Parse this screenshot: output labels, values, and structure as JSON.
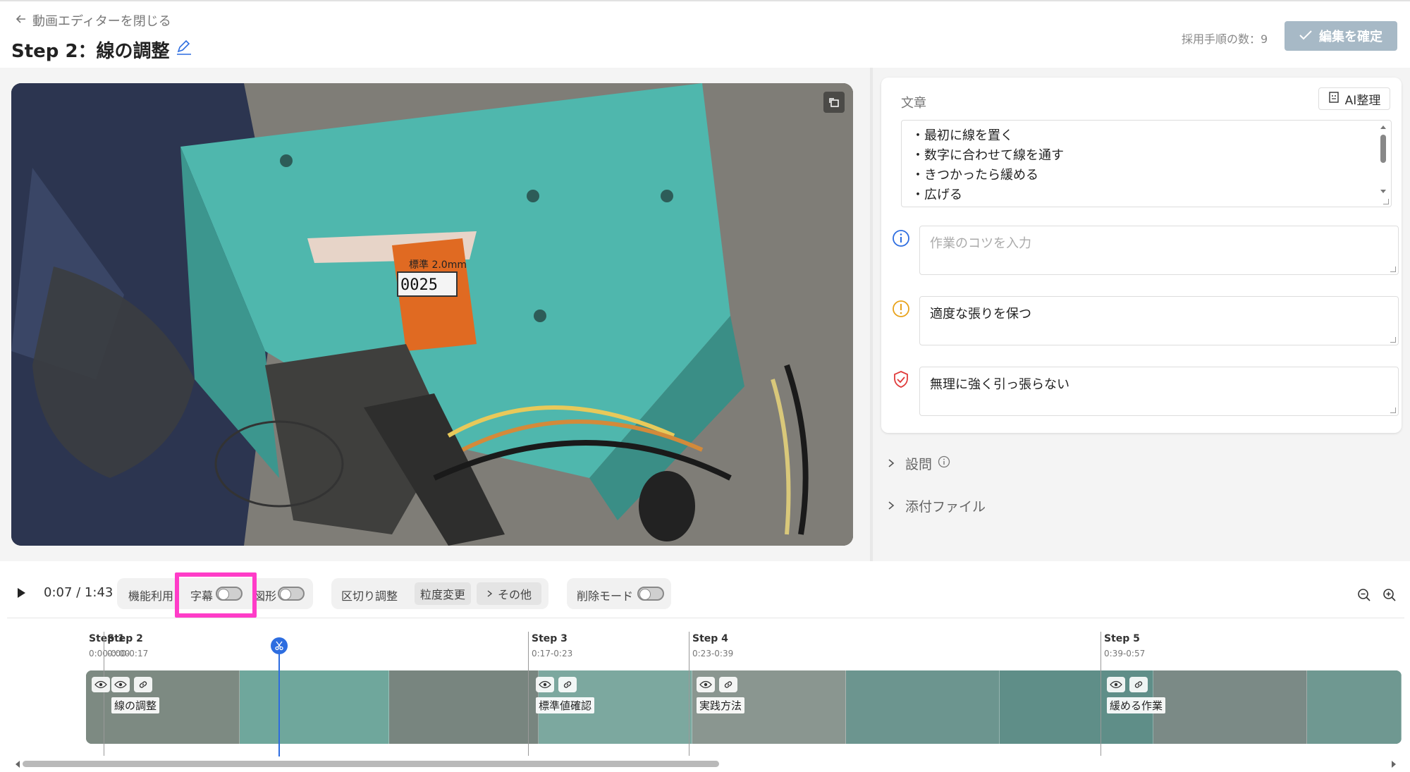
{
  "header": {
    "close_label": "動画エディターを閉じる",
    "step_title": "Step 2：線の調整",
    "adopt_count": "採用手順の数：9",
    "confirm_label": "編集を確定"
  },
  "video": {
    "counter_text": "0025",
    "label_text": "標準 2.0mm"
  },
  "editor": {
    "section_label": "文章",
    "ai_button": "AI整理",
    "body_lines": [
      "・最初に線を置く",
      "・数字に合わせて線を通す",
      "・きつかったら緩める",
      "・広げる"
    ],
    "tip_placeholder": "作業のコツを入力",
    "caution_text": "適度な張りを保つ",
    "safety_text": "無理に強く引っ張らない",
    "questions_label": "設問",
    "attachments_label": "添付ファイル"
  },
  "controls": {
    "time": "0:07 / 1:43",
    "feature_label": "機能利用",
    "subtitle_label": "字幕",
    "shape_label": "図形",
    "split_label": "区切り調整",
    "granularity_label": "粒度変更",
    "other_label": "その他",
    "delete_mode_label": "削除モード"
  },
  "timeline": {
    "steps": [
      {
        "label": "Step 1",
        "range": "0:00-0:00",
        "tag": ""
      },
      {
        "label": "Step 2",
        "range": "0:00-0:17",
        "tag": "線の調整"
      },
      {
        "label": "Step 3",
        "range": "0:17-0:23",
        "tag": "標準値確認"
      },
      {
        "label": "Step 4",
        "range": "0:23-0:39",
        "tag": "実践方法"
      },
      {
        "label": "Step 5",
        "range": "0:39-0:57",
        "tag": "緩める作業"
      }
    ]
  },
  "colors": {
    "accent": "#2d6de0",
    "highlight": "#ff3cc8",
    "confirm_bg": "#a7b9c6",
    "machine_teal": "#4fb7ad",
    "counter_orange": "#e06a22"
  }
}
